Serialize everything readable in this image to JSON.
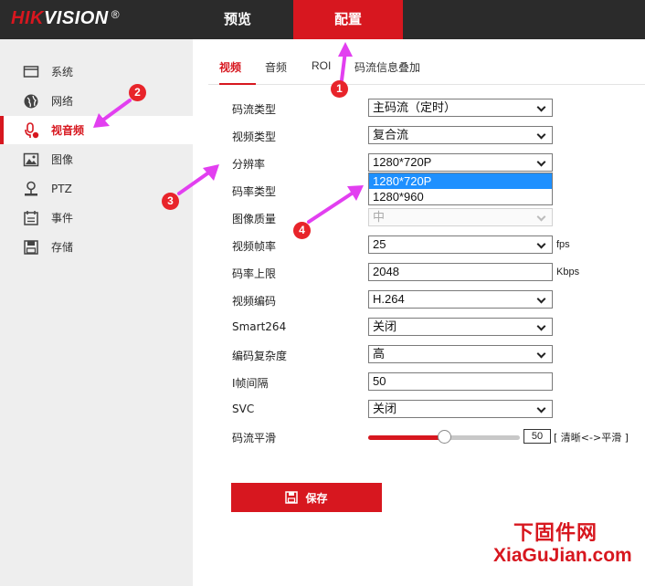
{
  "brand": {
    "logo_red": "HIK",
    "logo_white": "VISION",
    "logo_reg": "®"
  },
  "topnav": [
    {
      "label": "预览",
      "active": false
    },
    {
      "label": "配置",
      "active": true
    }
  ],
  "sidebar": {
    "items": [
      {
        "label": "系统",
        "icon": "monitor-icon"
      },
      {
        "label": "网络",
        "icon": "globe-icon"
      },
      {
        "label": "视音频",
        "icon": "microphone-icon",
        "active": true
      },
      {
        "label": "图像",
        "icon": "image-icon"
      },
      {
        "label": "PTZ",
        "icon": "ptz-icon"
      },
      {
        "label": "事件",
        "icon": "calendar-icon"
      },
      {
        "label": "存储",
        "icon": "disk-icon"
      }
    ]
  },
  "tabs": [
    {
      "label": "视频",
      "active": true
    },
    {
      "label": "音频"
    },
    {
      "label": "ROI"
    },
    {
      "label": "码流信息叠加"
    }
  ],
  "form": {
    "stream_type": {
      "label": "码流类型",
      "value": "主码流（定时）"
    },
    "video_type": {
      "label": "视频类型",
      "value": "复合流"
    },
    "resolution": {
      "label": "分辨率",
      "value": "1280*720P",
      "options": [
        "1280*720P",
        "1280*960"
      ]
    },
    "bitrate_type": {
      "label": "码率类型"
    },
    "image_quality": {
      "label": "图像质量",
      "value": "中"
    },
    "frame_rate": {
      "label": "视频帧率",
      "value": "25",
      "unit": "fps"
    },
    "max_bitrate": {
      "label": "码率上限",
      "value": "2048",
      "unit": "Kbps"
    },
    "video_encoding": {
      "label": "视频编码",
      "value": "H.264"
    },
    "smart264": {
      "label": "Smart264",
      "value": "关闭"
    },
    "complexity": {
      "label": "编码复杂度",
      "value": "高"
    },
    "i_frame_interval": {
      "label": "I帧间隔",
      "value": "50"
    },
    "svc": {
      "label": "SVC",
      "value": "关闭"
    },
    "smoothing": {
      "label": "码流平滑",
      "value": "50",
      "hint": "[ 清晰<->平滑 ]",
      "fraction": 0.5
    }
  },
  "save_label": "保存",
  "annotations": {
    "m1": "1",
    "m2": "2",
    "m3": "3",
    "m4": "4"
  },
  "watermark": {
    "line1": "下固件网",
    "line2": "XiaGuJian.com"
  },
  "colors": {
    "accent": "#d7171f",
    "topbar": "#2b2b2b",
    "sidebar": "#eeeeee",
    "annotation": "#e8242a",
    "arrow": "#e23ff0",
    "selected": "#1e90ff"
  }
}
